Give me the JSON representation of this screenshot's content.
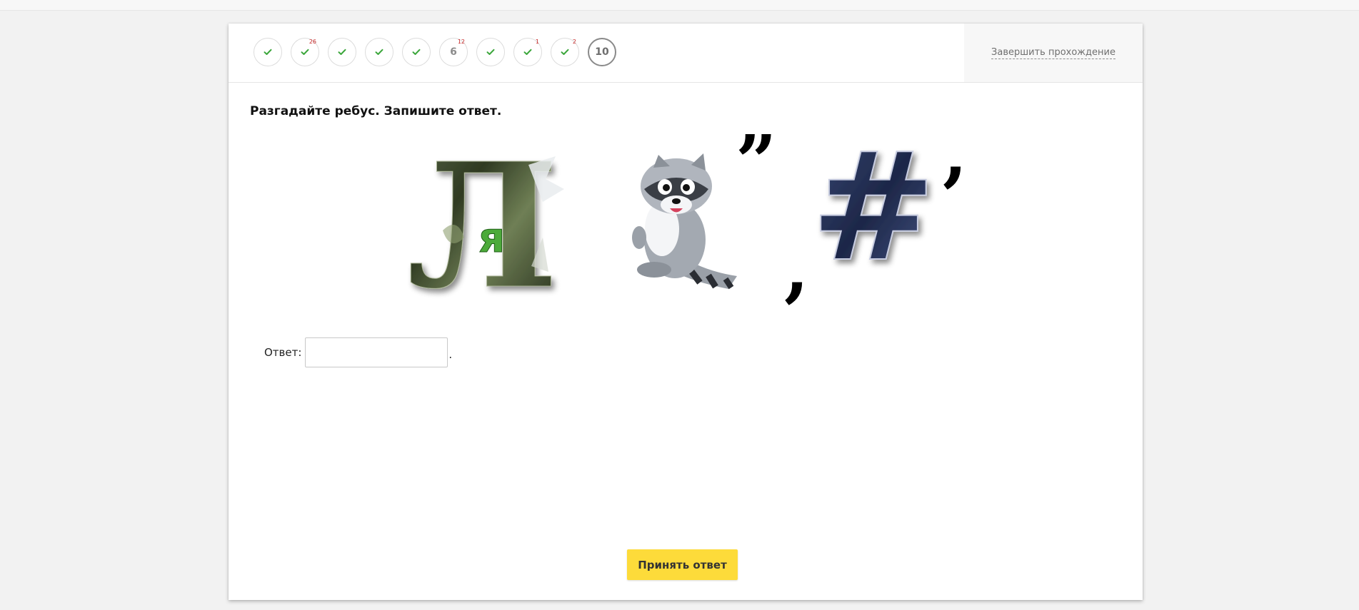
{
  "header": {
    "steps": [
      {
        "status": "done",
        "badge": ""
      },
      {
        "status": "done",
        "badge": "26"
      },
      {
        "status": "done",
        "badge": ""
      },
      {
        "status": "done",
        "badge": ""
      },
      {
        "status": "done",
        "badge": ""
      },
      {
        "status": "number",
        "label": "6",
        "badge": "12"
      },
      {
        "status": "done",
        "badge": ""
      },
      {
        "status": "done",
        "badge": "1"
      },
      {
        "status": "done",
        "badge": "2"
      },
      {
        "status": "current",
        "label": "10",
        "badge": ""
      }
    ],
    "finish_label": "Завершить прохождение"
  },
  "question": {
    "text": "Разгадайте ребус. Запишите ответ."
  },
  "rebus": {
    "big_letter": "Л",
    "small_letter": "я",
    "hash_symbol": "#",
    "quote_marks": "”",
    "comma": ","
  },
  "answer": {
    "label": "Ответ:",
    "value": "",
    "trailing": "."
  },
  "submit_label": "Принять ответ",
  "colors": {
    "check": "#3aa63a",
    "badge": "#c62828",
    "button": "#fddb3a"
  }
}
